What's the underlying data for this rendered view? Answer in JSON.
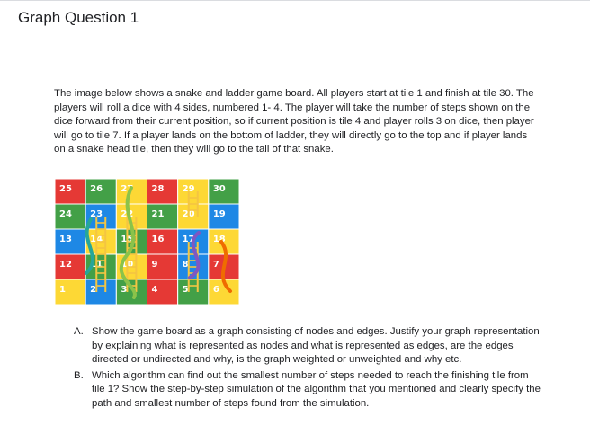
{
  "page": {
    "title": "Graph Question 1",
    "intro": "The image below shows a snake and ladder game board. All players start at tile 1 and finish at tile 30. The players will roll a dice with 4 sides, numbered 1- 4. The player will take the number of steps shown on the dice forward from their current position, so if current position is tile 4 and player rolls 3 on dice, then player will go to tile 7. If a player lands on the bottom of ladder, they will directly go to the top and if player lands on a snake head tile, then they will go to the tail of that snake."
  },
  "board": {
    "rows": [
      [
        {
          "n": "25",
          "c": "#e53935"
        },
        {
          "n": "26",
          "c": "#43a047"
        },
        {
          "n": "27",
          "c": "#fdd835"
        },
        {
          "n": "28",
          "c": "#e53935"
        },
        {
          "n": "29",
          "c": "#fdd835"
        },
        {
          "n": "30",
          "c": "#43a047"
        }
      ],
      [
        {
          "n": "24",
          "c": "#43a047"
        },
        {
          "n": "23",
          "c": "#1e88e5"
        },
        {
          "n": "22",
          "c": "#fdd835"
        },
        {
          "n": "21",
          "c": "#43a047"
        },
        {
          "n": "20",
          "c": "#fdd835"
        },
        {
          "n": "19",
          "c": "#1e88e5"
        }
      ],
      [
        {
          "n": "13",
          "c": "#1e88e5"
        },
        {
          "n": "14",
          "c": "#fdd835"
        },
        {
          "n": "15",
          "c": "#43a047"
        },
        {
          "n": "16",
          "c": "#e53935"
        },
        {
          "n": "17",
          "c": "#1e88e5"
        },
        {
          "n": "18",
          "c": "#fdd835"
        }
      ],
      [
        {
          "n": "12",
          "c": "#e53935"
        },
        {
          "n": "11",
          "c": "#43a047"
        },
        {
          "n": "10",
          "c": "#fdd835"
        },
        {
          "n": "9",
          "c": "#e53935"
        },
        {
          "n": "8",
          "c": "#1e88e5"
        },
        {
          "n": "7",
          "c": "#e53935"
        }
      ],
      [
        {
          "n": "1",
          "c": "#fdd835"
        },
        {
          "n": "2",
          "c": "#1e88e5"
        },
        {
          "n": "3",
          "c": "#43a047"
        },
        {
          "n": "4",
          "c": "#e53935"
        },
        {
          "n": "5",
          "c": "#43a047"
        },
        {
          "n": "6",
          "c": "#fdd835"
        }
      ]
    ],
    "colors": {
      "red": "#e53935",
      "yellow": "#fdd835",
      "green": "#43a047",
      "blue": "#1e88e5",
      "ladder": "#f4c542",
      "snake": "#8bc34a"
    }
  },
  "questions": [
    {
      "marker": "A.",
      "text": "Show the game board as a graph consisting of nodes and edges. Justify your graph representation by explaining what is represented as nodes and what is represented as edges, are the edges directed or undirected and why, is the graph weighted or unweighted and why etc."
    },
    {
      "marker": "B.",
      "text": "Which algorithm can find out the smallest number of steps needed to reach the finishing tile from tile 1? Show the step-by-step simulation of the algorithm that you mentioned and clearly specify the path and smallest number of steps found from the simulation."
    }
  ]
}
